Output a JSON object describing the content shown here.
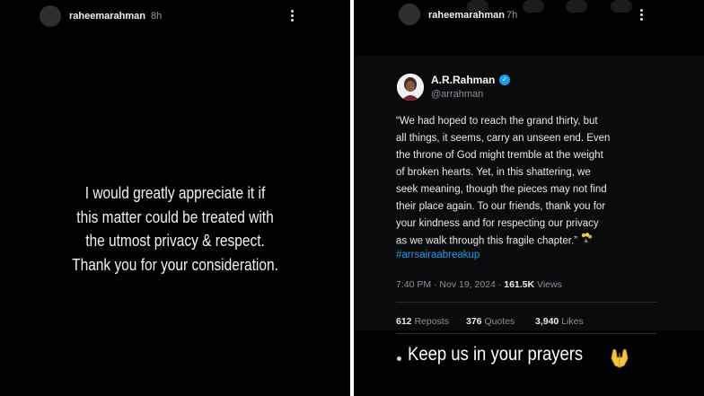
{
  "left_story": {
    "username": "raheemarahman",
    "time": "8h",
    "message_lines": [
      "I would greatly appreciate it if",
      "this matter could be treated with",
      "the utmost privacy & respect.",
      "Thank you for your consideration."
    ]
  },
  "right_story": {
    "username": "raheemarahman",
    "time": "7h",
    "tweet": {
      "name": "A.R.Rahman",
      "handle": "@arrahman",
      "body_lines": [
        "“We had hoped to reach the grand thirty, but",
        "all things, it seems, carry an unseen end. Even",
        "the throne of God might tremble at the weight",
        "of broken hearts. Yet, in this shattering, we",
        "seek meaning, though the pieces may not find",
        "their place again. To our friends, thank you for",
        "your kindness and for respecting our privacy",
        "as we walk through this fragile chapter.”"
      ],
      "hashtag": "#arrsairaabreakup",
      "timestamp": "7:40 PM · Nov 19, 2024 ·",
      "views_count": "161.5K",
      "views_label": "Views",
      "reposts_count": "612",
      "reposts_label": "Reposts",
      "quotes_count": "376",
      "quotes_label": "Quotes",
      "likes_count": "3,940",
      "likes_label": "Likes"
    },
    "caption": "Keep us in your prayers"
  },
  "colors": {
    "background": "#000000",
    "link_blue": "#1d9bf0",
    "muted_text": "#8b8f94"
  },
  "icons": [
    "more-vertical-icon",
    "verified-badge-icon",
    "bouquet-emoji-icon",
    "praying-hands-emoji-icon"
  ]
}
